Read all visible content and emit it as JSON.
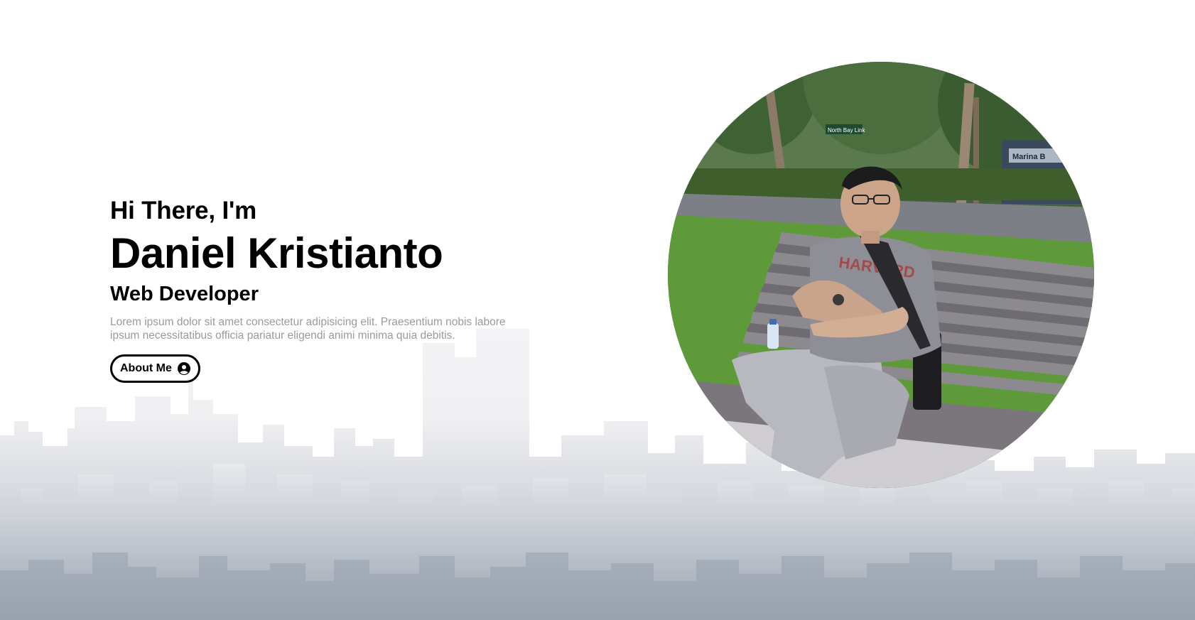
{
  "hero": {
    "greeting": "Hi There, I'm",
    "name": "Daniel Kristianto",
    "role": "Web Developer",
    "bio": "Lorem ipsum dolor sit amet consectetur adipisicing elit. Praesentium nobis labore ipsum necessitatibus officia pariatur eligendi animi minima quia debitis.",
    "button": {
      "label": "About Me",
      "icon": "user-circle-icon"
    }
  },
  "photo": {
    "subject": "portrait photo",
    "signs": {
      "street_sign": "North Bay Link",
      "building_sign": "Marina B"
    },
    "shirt_text": "HARVARD"
  },
  "colors": {
    "text": "#000000",
    "muted": "#9a9a9a",
    "skyline_top": "#f3f3f5",
    "skyline_bottom": "#a3abb6"
  }
}
